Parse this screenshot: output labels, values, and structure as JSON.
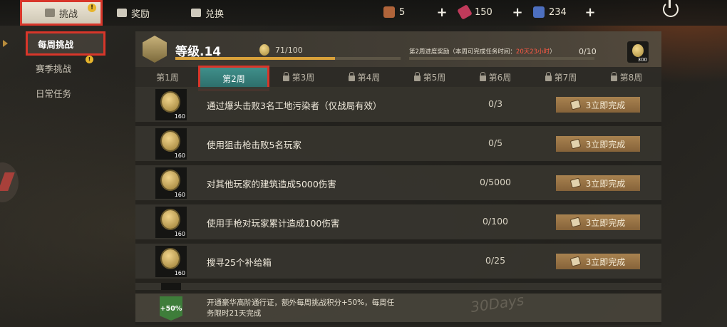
{
  "topbar": {
    "tabs": [
      {
        "label": "挑战",
        "badge": "!"
      },
      {
        "label": "奖励"
      },
      {
        "label": "兑换"
      }
    ],
    "resources": [
      {
        "icon": "ticket-icon",
        "value": "5"
      },
      {
        "icon": "battery-icon",
        "value": "150"
      },
      {
        "icon": "card-icon",
        "value": "234"
      }
    ],
    "plus": "+"
  },
  "sidebar": {
    "items": [
      {
        "label": "每周挑战"
      },
      {
        "label": "赛季挑战",
        "badge": "!"
      },
      {
        "label": "日常任务"
      }
    ]
  },
  "level": {
    "title": "等级.14",
    "progress_text": "71/100",
    "progress_fraction": 0.71
  },
  "week_reward": {
    "label": "第2周进度奖励（本周可完成任务时间：",
    "time": "20天23小时",
    "suffix": "）",
    "count": "0/10",
    "coin_amount": "300"
  },
  "weeks": [
    {
      "label": "第1周",
      "locked": false
    },
    {
      "label": "第2周",
      "locked": false,
      "active": true
    },
    {
      "label": "第3周",
      "locked": true
    },
    {
      "label": "第4周",
      "locked": true
    },
    {
      "label": "第5周",
      "locked": true
    },
    {
      "label": "第6周",
      "locked": true
    },
    {
      "label": "第7周",
      "locked": true
    },
    {
      "label": "第8周",
      "locked": true
    }
  ],
  "tasks": [
    {
      "reward": "160",
      "text": "通过爆头击败3名工地污染者（仅战局有效）",
      "progress": "0/3",
      "button": "3立即完成"
    },
    {
      "reward": "160",
      "text": "使用狙击枪击败5名玩家",
      "progress": "0/5",
      "button": "3立即完成"
    },
    {
      "reward": "160",
      "text": "对其他玩家的建筑造成5000伤害",
      "progress": "0/5000",
      "button": "3立即完成"
    },
    {
      "reward": "160",
      "text": "使用手枪对玩家累计造成100伤害",
      "progress": "0/100",
      "button": "3立即完成"
    },
    {
      "reward": "160",
      "text": "搜寻25个补给箱",
      "progress": "0/25",
      "button": "3立即完成"
    }
  ],
  "banner": {
    "badge": "+50%",
    "text": "开通豪华高阶通行证，额外每周挑战积分+50%，每周任务限时21天完成",
    "stamp": "30Days"
  },
  "colors": {
    "highlight_border": "#d8362a",
    "active_week": "#3f8f8a",
    "button": "#a88250",
    "accent_gold": "#d9a13a",
    "time_red": "#ff5a45"
  }
}
